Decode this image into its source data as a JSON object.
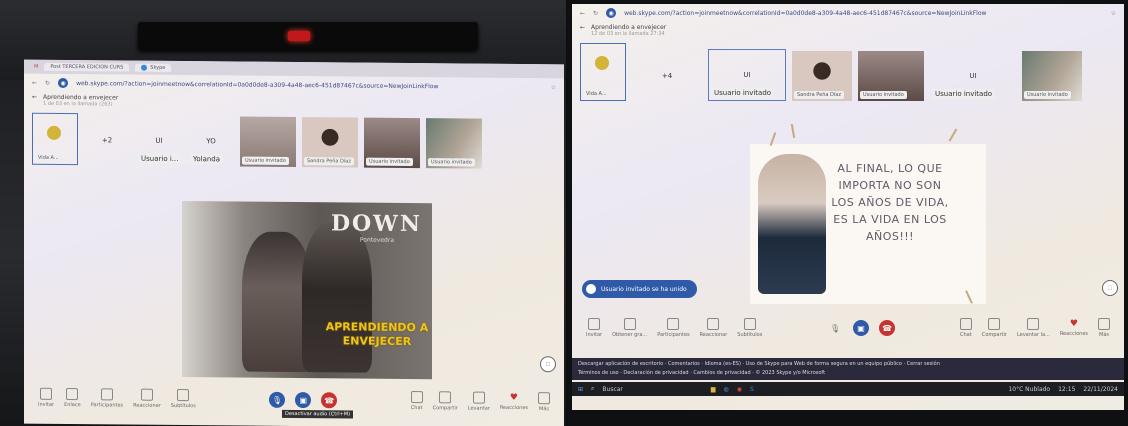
{
  "left": {
    "tabs": [
      {
        "label": "Post TERCERA EDICION CURS"
      },
      {
        "label": "Skype"
      }
    ],
    "url": "web.skype.com/?action=joinmeetnow&correlationId=0a0d0de8-a309-4a48-aec6-451d87467c&source=NewJoinLinkFlow",
    "meeting": {
      "title": "Aprendiendo a envejecer",
      "subtitle": "1 de 03 en la llamada (263)"
    },
    "participants": [
      {
        "name": "Vida A...",
        "kind": "self"
      },
      {
        "label": "+2",
        "kind": "count"
      },
      {
        "label": "UI",
        "name": "Usuario i...",
        "kind": "initials"
      },
      {
        "label": "YO",
        "name": "Yolanda",
        "kind": "initials"
      },
      {
        "name": "Usuario invitado",
        "kind": "img"
      },
      {
        "name": "Sandra Peña Díaz",
        "kind": "img"
      },
      {
        "name": "Usuario invitado",
        "kind": "img"
      },
      {
        "name": "Usuario invitado",
        "kind": "img"
      }
    ],
    "slide": {
      "brand": "DOWN",
      "brand_sub": "Pontevedra",
      "title": "APRENDIENDO A ENVEJECER"
    },
    "controls": {
      "left": [
        "Invitar",
        "Enlace",
        "Participantes",
        "Reaccionar",
        "Subtítulos"
      ],
      "right": [
        "Chat",
        "Compartir",
        "Levantar",
        "Reacciones",
        "Más"
      ],
      "tooltip": "Desactivar audio (Ctrl+M)"
    }
  },
  "right": {
    "url": "web.skype.com/?action=joinmeetnow&correlationId=0a0d0de8-a309-4a48-aec6-451d87467c&source=NewJoinLinkFlow",
    "meeting": {
      "title": "Aprendiendo a envejecer",
      "subtitle": "12 de 03 en la llamada 27:34"
    },
    "participants": [
      {
        "name": "Vida A...",
        "kind": "self"
      },
      {
        "label": "+4",
        "kind": "count"
      },
      {
        "label": "UI",
        "name": "Usuario invitado",
        "kind": "initials"
      },
      {
        "name": "Sandra Peña Díaz",
        "kind": "img"
      },
      {
        "name": "Usuario invitado",
        "kind": "img"
      },
      {
        "label": "UI",
        "name": "Usuario invitado",
        "kind": "initials"
      },
      {
        "name": "Usuario invitado",
        "kind": "img"
      }
    ],
    "slide": {
      "quote": "AL FINAL, LO QUE IMPORTA NO SON LOS AÑOS DE VIDA, ES LA VIDA EN LOS AÑOS!!!"
    },
    "toast": "Usuario invitado se ha unido",
    "controls": {
      "left": [
        "Invitar",
        "Obtener gra...",
        "Participantes",
        "Reaccionar",
        "Subtítulos"
      ],
      "right": [
        "Chat",
        "Compartir",
        "Levantar la...",
        "Reacciones",
        "Más"
      ]
    },
    "status_lines": [
      "Descargar aplicación de escritorio · Comentarios · Idioma (es-ES) · Uso de Skype para Web de forma segura en un equipo público · Cerrar sesión",
      "Términos de uso · Declaración de privacidad · Cambios de privacidad · © 2023 Skype y/o Microsoft"
    ],
    "taskbar": {
      "search": "Buscar",
      "weather": "10°C Nublado",
      "clock": "12:15",
      "date": "22/11/2024"
    }
  },
  "colors": {
    "accent": "#2f5aa8",
    "hangup": "#c7332f",
    "slide_title": "#f0c519"
  }
}
